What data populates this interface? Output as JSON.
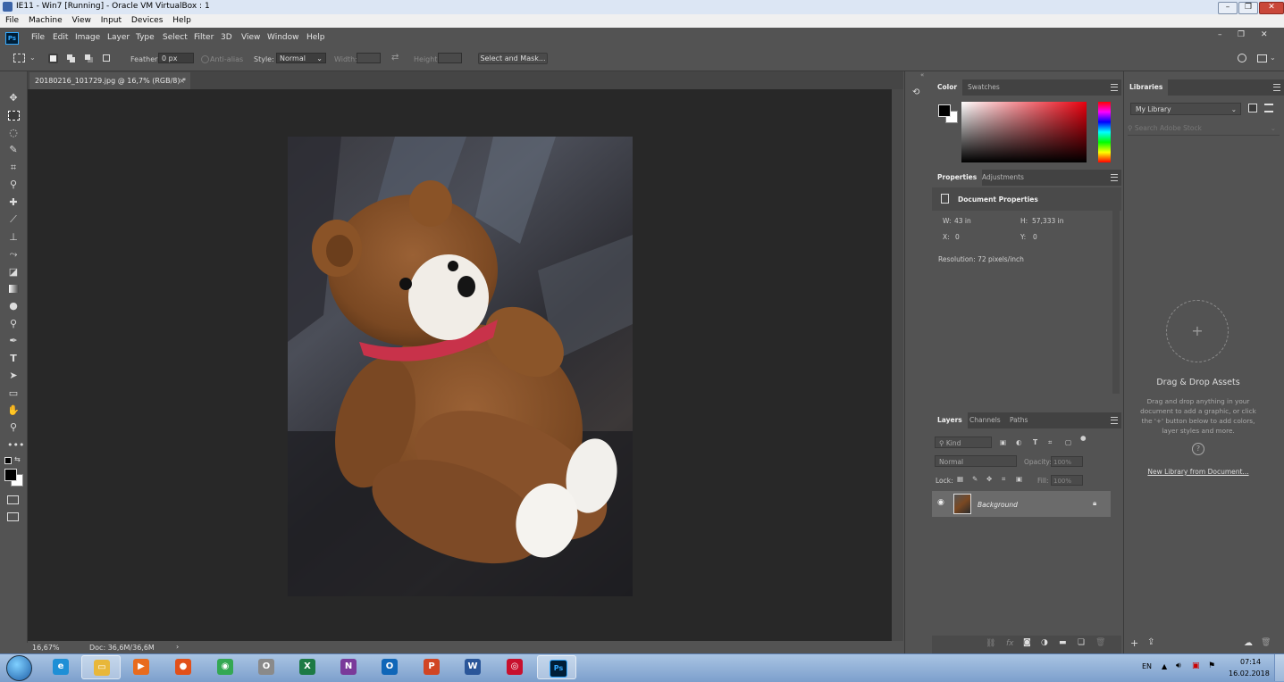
{
  "vbox": {
    "title": "IE11 - Win7 [Running] - Oracle VM VirtualBox : 1",
    "menu": [
      "File",
      "Machine",
      "View",
      "Input",
      "Devices",
      "Help"
    ]
  },
  "ps": {
    "logo": "Ps",
    "menu": [
      "File",
      "Edit",
      "Image",
      "Layer",
      "Type",
      "Select",
      "Filter",
      "3D",
      "View",
      "Window",
      "Help"
    ],
    "options": {
      "feather_label": "Feather:",
      "feather_value": "0 px",
      "antialias_label": "Anti-alias",
      "style_label": "Style:",
      "style_value": "Normal",
      "width_label": "Width:",
      "height_label": "Height:",
      "select_mask_label": "Select and Mask..."
    },
    "document_tab": "20180216_101729.jpg @ 16,7% (RGB/8) *",
    "status": {
      "zoom": "16,67%",
      "doc": "Doc: 36,6M/36,6M",
      "arrow": "›"
    },
    "color_panel": {
      "tabs": [
        "Color",
        "Swatches"
      ],
      "foreground": "#000000",
      "background": "#ffffff",
      "hue_color": "#e8000e"
    },
    "properties_panel": {
      "tabs": [
        "Properties",
        "Adjustments"
      ],
      "title": "Document Properties",
      "w_label": "W:",
      "w_value": "43 in",
      "h_label": "H:",
      "h_value": "57,333 in",
      "x_label": "X:",
      "x_value": "0",
      "y_label": "Y:",
      "y_value": "0",
      "resolution": "Resolution: 72 pixels/inch"
    },
    "layers_panel": {
      "tabs": [
        "Layers",
        "Channels",
        "Paths"
      ],
      "kind": "Kind",
      "blend_mode": "Normal",
      "opacity_label": "Opacity:",
      "opacity_value": "100%",
      "lock_label": "Lock:",
      "fill_label": "Fill:",
      "fill_value": "100%",
      "layers": [
        {
          "name": "Background",
          "visible": true,
          "locked": true
        }
      ]
    },
    "libraries_panel": {
      "tab": "Libraries",
      "library": "My Library",
      "search_placeholder": "Search Adobe Stock",
      "drag_title": "Drag & Drop Assets",
      "drag_desc": "Drag and drop anything in your document to add a graphic, or click the '+' button below to add colors, layer styles and more.",
      "new_library_link": "New Library from Document..."
    }
  },
  "taskbar": {
    "language": "EN",
    "time": "07:14",
    "date": "16.02.2018",
    "apps": [
      {
        "name": "Internet Explorer",
        "glyph": "e",
        "color": "#1e8fd6"
      },
      {
        "name": "Windows Explorer",
        "glyph": "▭",
        "color": "#e8b73a"
      },
      {
        "name": "Media Player",
        "glyph": "▶",
        "color": "#e86b1e"
      },
      {
        "name": "Firefox",
        "glyph": "●",
        "color": "#e2501a"
      },
      {
        "name": "Chrome",
        "glyph": "◉",
        "color": "#34a853"
      },
      {
        "name": "Opera",
        "glyph": "O",
        "color": "#8a8a8a"
      },
      {
        "name": "Excel",
        "glyph": "X",
        "color": "#1d7a45"
      },
      {
        "name": "OneNote",
        "glyph": "N",
        "color": "#7a3a9a"
      },
      {
        "name": "Outlook",
        "glyph": "O",
        "color": "#0f66b8"
      },
      {
        "name": "PowerPoint",
        "glyph": "P",
        "color": "#d14524"
      },
      {
        "name": "Word",
        "glyph": "W",
        "color": "#2a5699"
      },
      {
        "name": "Creative Cloud",
        "glyph": "◎",
        "color": "#c8102e"
      },
      {
        "name": "Photoshop",
        "glyph": "Ps",
        "color": "#001e36"
      }
    ]
  }
}
